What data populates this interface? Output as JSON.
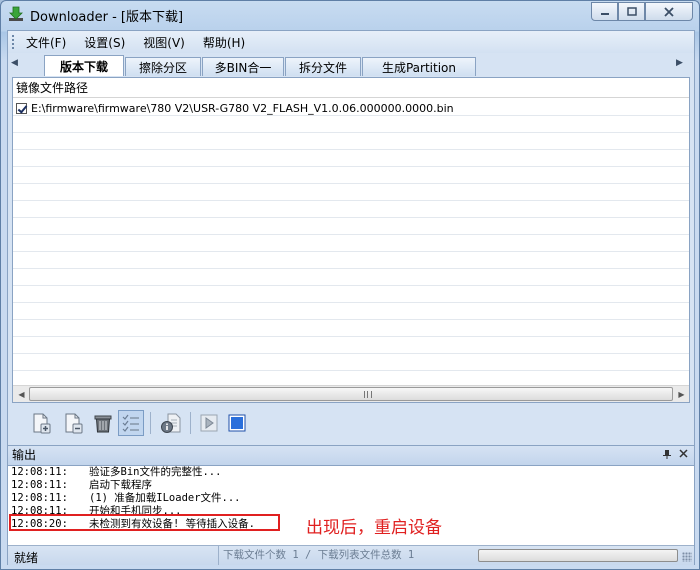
{
  "window": {
    "title": "Downloader - [版本下载]"
  },
  "menu": [
    {
      "label": "文件(F)"
    },
    {
      "label": "设置(S)"
    },
    {
      "label": "视图(V)"
    },
    {
      "label": "帮助(H)"
    }
  ],
  "tabs": [
    {
      "label": "版本下载",
      "active": true
    },
    {
      "label": "擦除分区"
    },
    {
      "label": "多BIN合一"
    },
    {
      "label": "拆分文件"
    },
    {
      "label": "生成Partition"
    }
  ],
  "file_list": {
    "header": "镜像文件路径",
    "rows": [
      {
        "checked": true,
        "path": "E:\\firmware\\firmware\\780 V2\\USR-G780 V2_FLASH_V1.0.06.000000.0000.bin"
      }
    ]
  },
  "toolbar": {
    "buttons": [
      "add-file-icon",
      "remove-file-icon",
      "trash-icon",
      "checklist-icon",
      "info-icon",
      "play-icon",
      "stop-icon"
    ]
  },
  "output": {
    "title": "输出",
    "lines": [
      {
        "time": "12:08:11:",
        "text": "验证多Bin文件的完整性..."
      },
      {
        "time": "12:08:11:",
        "text": "启动下载程序"
      },
      {
        "time": "12:08:11:",
        "text": "(1) 准备加载ILoader文件..."
      },
      {
        "time": "12:08:11:",
        "text": "开始和手机同步..."
      },
      {
        "time": "12:08:20:",
        "text": "未检测到有效设备! 等待插入设备."
      }
    ],
    "annotation": "出现后，重启设备",
    "annotation_color": "#e02020"
  },
  "status": {
    "ready": "就绪",
    "counts": "下载文件个数 1 / 下载列表文件总数 1"
  }
}
